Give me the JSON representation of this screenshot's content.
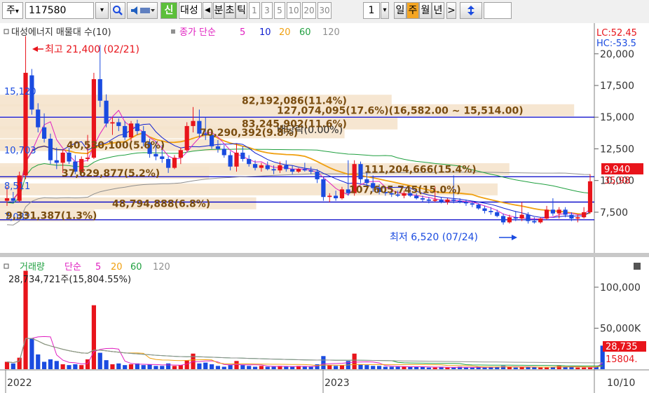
{
  "toolbar": {
    "period_type": "주",
    "stock_code": "117580",
    "new_badge": "신",
    "stock_name_prefix": "대성",
    "nav_prev": "◀",
    "unit_minute": "분",
    "unit_second": "초",
    "unit_tick": "틱",
    "interval_options": [
      "1",
      "3",
      "5",
      "10",
      "20",
      "30"
    ],
    "count": "1",
    "period_day": "일",
    "period_week": "주",
    "period_month": "월",
    "period_year": "년",
    "nav_next": ">",
    "dropdown_arrow": "▾"
  },
  "colors": {
    "up": "#e8141b",
    "down": "#1a4be0",
    "ma5": "#e020c0",
    "ma10": "#1020d0",
    "ma20": "#f0a010",
    "ma60": "#20a040",
    "ma120": "#909090",
    "hline": "#0000c8",
    "vp_band": "#f5e3cc",
    "vp_text": "#7a4d10"
  },
  "chart_data": [
    {
      "type": "candlestick",
      "legend": {
        "vp_label": "대성에너지 매물대 수(10)",
        "ma_label": "종가 단순",
        "ma_periods": [
          "5",
          "10",
          "20",
          "60",
          "120"
        ]
      },
      "y_ticks": [
        "20,000",
        "17,500",
        "15,000",
        "12,500",
        "10,000",
        "7,500"
      ],
      "y_tick_values": [
        20000,
        17500,
        15000,
        12500,
        10000,
        7500
      ],
      "ylim": [
        4400,
        22200
      ],
      "top_labels": [
        "LC:52.45",
        "HC:-53.5"
      ],
      "price_tag": "9,940",
      "prev_tag": "35,98",
      "max_annotation": "최고 21,400 (02/21)",
      "min_annotation": "최저 6,520 (07/24)",
      "dividend_label": "배당락(0.00%)",
      "left_labels": [
        "15,120",
        "10,703",
        "8,511",
        "7,082"
      ],
      "horizontal_lines": [
        15000,
        10300,
        8300,
        6900
      ],
      "volume_profile": [
        {
          "price": 16300,
          "label": "82,192,086(11.4%)"
        },
        {
          "price": 15550,
          "label": "127,074,095(17.6%)(16,582.00 ~ 15,514.00)"
        },
        {
          "price": 14500,
          "label": "83,245,902(11.6%)"
        },
        {
          "price": 13800,
          "label": "70,290,392(9.8%)"
        },
        {
          "price": 12800,
          "label": "40,530,100(5.6%)"
        },
        {
          "price": 10900,
          "label": "111,204,666(15.4%)"
        },
        {
          "price": 10600,
          "label": "37,629,877(5.2%)"
        },
        {
          "price": 9300,
          "label": "107,605,745(15.0%)"
        },
        {
          "price": 8200,
          "label": "48,794,888(6.8%)"
        },
        {
          "price": 7250,
          "label": "9,331,387(1.3%)"
        }
      ],
      "candles": [
        {
          "o": 8400,
          "h": 9500,
          "l": 8000,
          "c": 8600
        },
        {
          "o": 8600,
          "h": 9100,
          "l": 8200,
          "c": 8400
        },
        {
          "o": 8400,
          "h": 10700,
          "l": 8300,
          "c": 10400
        },
        {
          "o": 10400,
          "h": 21400,
          "l": 10100,
          "c": 18500
        },
        {
          "o": 18300,
          "h": 18800,
          "l": 15200,
          "c": 15600
        },
        {
          "o": 15600,
          "h": 16100,
          "l": 13800,
          "c": 14200
        },
        {
          "o": 14200,
          "h": 15300,
          "l": 13000,
          "c": 13300
        },
        {
          "o": 13300,
          "h": 13700,
          "l": 11300,
          "c": 11600
        },
        {
          "o": 11600,
          "h": 12600,
          "l": 10900,
          "c": 11400
        },
        {
          "o": 11400,
          "h": 12400,
          "l": 10600,
          "c": 12200
        },
        {
          "o": 12200,
          "h": 12600,
          "l": 11300,
          "c": 11500
        },
        {
          "o": 11500,
          "h": 12000,
          "l": 10500,
          "c": 10700
        },
        {
          "o": 10700,
          "h": 11900,
          "l": 10500,
          "c": 11700
        },
        {
          "o": 11700,
          "h": 13600,
          "l": 11500,
          "c": 11800
        },
        {
          "o": 11800,
          "h": 18500,
          "l": 11700,
          "c": 18000
        },
        {
          "o": 18000,
          "h": 20700,
          "l": 15800,
          "c": 16300
        },
        {
          "o": 16300,
          "h": 16800,
          "l": 14200,
          "c": 14500
        },
        {
          "o": 14500,
          "h": 15000,
          "l": 13600,
          "c": 14600
        },
        {
          "o": 14600,
          "h": 14900,
          "l": 13900,
          "c": 14300
        },
        {
          "o": 14300,
          "h": 14700,
          "l": 13200,
          "c": 13400
        },
        {
          "o": 13400,
          "h": 14700,
          "l": 13100,
          "c": 14500
        },
        {
          "o": 14500,
          "h": 14800,
          "l": 13600,
          "c": 13900
        },
        {
          "o": 13900,
          "h": 14300,
          "l": 12700,
          "c": 13000
        },
        {
          "o": 13000,
          "h": 13300,
          "l": 11800,
          "c": 12100
        },
        {
          "o": 12100,
          "h": 13100,
          "l": 11600,
          "c": 11900
        },
        {
          "o": 11900,
          "h": 12800,
          "l": 11400,
          "c": 11700
        },
        {
          "o": 11700,
          "h": 11900,
          "l": 10600,
          "c": 11000
        },
        {
          "o": 11000,
          "h": 12000,
          "l": 10900,
          "c": 11800
        },
        {
          "o": 11800,
          "h": 12600,
          "l": 11300,
          "c": 12400
        },
        {
          "o": 12400,
          "h": 14600,
          "l": 12300,
          "c": 14300
        },
        {
          "o": 14300,
          "h": 15800,
          "l": 13800,
          "c": 14700
        },
        {
          "o": 14700,
          "h": 15600,
          "l": 13400,
          "c": 13700
        },
        {
          "o": 13700,
          "h": 15000,
          "l": 13200,
          "c": 13600
        },
        {
          "o": 13600,
          "h": 13900,
          "l": 12500,
          "c": 12700
        },
        {
          "o": 12700,
          "h": 13200,
          "l": 12200,
          "c": 12500
        },
        {
          "o": 12500,
          "h": 12800,
          "l": 11800,
          "c": 12000
        },
        {
          "o": 12000,
          "h": 12300,
          "l": 10800,
          "c": 11100
        },
        {
          "o": 11100,
          "h": 12900,
          "l": 10700,
          "c": 12200
        },
        {
          "o": 12200,
          "h": 12700,
          "l": 11500,
          "c": 11700
        },
        {
          "o": 11700,
          "h": 12000,
          "l": 11100,
          "c": 11300
        },
        {
          "o": 11300,
          "h": 11600,
          "l": 10800,
          "c": 11000
        },
        {
          "o": 11000,
          "h": 11400,
          "l": 10700,
          "c": 11200
        },
        {
          "o": 11200,
          "h": 11500,
          "l": 10800,
          "c": 10900
        },
        {
          "o": 10900,
          "h": 11200,
          "l": 10500,
          "c": 10800
        },
        {
          "o": 10800,
          "h": 11500,
          "l": 10600,
          "c": 11200
        },
        {
          "o": 11200,
          "h": 11600,
          "l": 10700,
          "c": 10900
        },
        {
          "o": 10900,
          "h": 11200,
          "l": 10500,
          "c": 10700
        },
        {
          "o": 10700,
          "h": 11000,
          "l": 10600,
          "c": 10900
        },
        {
          "o": 10900,
          "h": 11400,
          "l": 10700,
          "c": 10800
        },
        {
          "o": 10800,
          "h": 11100,
          "l": 10500,
          "c": 10700
        },
        {
          "o": 10700,
          "h": 10900,
          "l": 9800,
          "c": 10100
        },
        {
          "o": 10100,
          "h": 10300,
          "l": 8400,
          "c": 8700
        },
        {
          "o": 8700,
          "h": 9000,
          "l": 8300,
          "c": 8800
        },
        {
          "o": 8800,
          "h": 9200,
          "l": 8400,
          "c": 8600
        },
        {
          "o": 8600,
          "h": 9500,
          "l": 8500,
          "c": 9300
        },
        {
          "o": 9300,
          "h": 11600,
          "l": 8800,
          "c": 9000
        },
        {
          "o": 9000,
          "h": 11600,
          "l": 8800,
          "c": 11300
        },
        {
          "o": 11300,
          "h": 11500,
          "l": 9800,
          "c": 10100
        },
        {
          "o": 10100,
          "h": 10700,
          "l": 9500,
          "c": 9800
        },
        {
          "o": 9800,
          "h": 10400,
          "l": 9100,
          "c": 9400
        },
        {
          "o": 9400,
          "h": 9700,
          "l": 8900,
          "c": 9100
        },
        {
          "o": 9100,
          "h": 9500,
          "l": 8800,
          "c": 9000
        },
        {
          "o": 9000,
          "h": 9300,
          "l": 8700,
          "c": 8900
        },
        {
          "o": 8900,
          "h": 9200,
          "l": 8700,
          "c": 8800
        },
        {
          "o": 8800,
          "h": 9200,
          "l": 8600,
          "c": 9000
        },
        {
          "o": 9000,
          "h": 9300,
          "l": 8700,
          "c": 8800
        },
        {
          "o": 8800,
          "h": 9000,
          "l": 8500,
          "c": 8600
        },
        {
          "o": 8600,
          "h": 8800,
          "l": 8300,
          "c": 8500
        },
        {
          "o": 8500,
          "h": 8700,
          "l": 8200,
          "c": 8400
        },
        {
          "o": 8400,
          "h": 9500,
          "l": 8300,
          "c": 8500
        },
        {
          "o": 8500,
          "h": 8700,
          "l": 8200,
          "c": 8300
        },
        {
          "o": 8300,
          "h": 8600,
          "l": 8100,
          "c": 8500
        },
        {
          "o": 8500,
          "h": 10400,
          "l": 8200,
          "c": 8400
        },
        {
          "o": 8400,
          "h": 8600,
          "l": 8200,
          "c": 8300
        },
        {
          "o": 8300,
          "h": 8500,
          "l": 8000,
          "c": 8200
        },
        {
          "o": 8200,
          "h": 8400,
          "l": 7900,
          "c": 8100
        },
        {
          "o": 8100,
          "h": 8200,
          "l": 7700,
          "c": 7800
        },
        {
          "o": 7800,
          "h": 8000,
          "l": 7400,
          "c": 7600
        },
        {
          "o": 7600,
          "h": 7900,
          "l": 7300,
          "c": 7500
        },
        {
          "o": 7500,
          "h": 7700,
          "l": 7100,
          "c": 7200
        },
        {
          "o": 7200,
          "h": 7400,
          "l": 6520,
          "c": 6700
        },
        {
          "o": 6700,
          "h": 7300,
          "l": 6600,
          "c": 7100
        },
        {
          "o": 7100,
          "h": 7600,
          "l": 6800,
          "c": 7000
        },
        {
          "o": 7000,
          "h": 8300,
          "l": 6800,
          "c": 7300
        },
        {
          "o": 7300,
          "h": 7500,
          "l": 6600,
          "c": 6800
        },
        {
          "o": 6800,
          "h": 7100,
          "l": 6600,
          "c": 6700
        },
        {
          "o": 6700,
          "h": 7100,
          "l": 6600,
          "c": 7000
        },
        {
          "o": 7000,
          "h": 8000,
          "l": 6900,
          "c": 7700
        },
        {
          "o": 7700,
          "h": 8600,
          "l": 7200,
          "c": 7400
        },
        {
          "o": 7400,
          "h": 7900,
          "l": 7000,
          "c": 7700
        },
        {
          "o": 7700,
          "h": 7900,
          "l": 7100,
          "c": 7300
        },
        {
          "o": 7300,
          "h": 7500,
          "l": 6800,
          "c": 7000
        },
        {
          "o": 7000,
          "h": 7300,
          "l": 6700,
          "c": 7100
        },
        {
          "o": 7100,
          "h": 7900,
          "l": 7000,
          "c": 7500
        },
        {
          "o": 7500,
          "h": 10500,
          "l": 7400,
          "c": 9940
        }
      ]
    },
    {
      "type": "bar",
      "legend": {
        "name": "거래량",
        "ma_label": "단순",
        "ma_periods": [
          "5",
          "20",
          "60",
          "120"
        ],
        "last_value": "28,734,721주(15,804.55%)"
      },
      "y_ticks": [
        "100,000",
        "50,000K"
      ],
      "y_tick_values": [
        100000,
        50000
      ],
      "ylim": [
        0,
        135000
      ],
      "last_tag": "28,735",
      "ma_tag": "15804.",
      "volumes": [
        9000,
        7000,
        14000,
        120000,
        38000,
        18000,
        9000,
        12000,
        10000,
        6000,
        5000,
        6000,
        5000,
        12000,
        78000,
        20000,
        11000,
        6000,
        7000,
        5000,
        6000,
        7000,
        5000,
        6000,
        4000,
        4000,
        7000,
        4000,
        5000,
        11000,
        19000,
        7000,
        8000,
        6000,
        4000,
        3000,
        5000,
        10000,
        5000,
        4000,
        3000,
        4000,
        3000,
        3000,
        4000,
        3000,
        3000,
        4000,
        3000,
        3000,
        6000,
        16000,
        5000,
        4000,
        5000,
        10000,
        19000,
        6000,
        5000,
        4000,
        4000,
        3000,
        3000,
        3000,
        3000,
        3000,
        3000,
        3000,
        2000,
        2000,
        3000,
        2000,
        2000,
        3000,
        2000,
        2000,
        3000,
        2000,
        3000,
        3000,
        4000,
        3000,
        2000,
        3000,
        3000,
        3000,
        2000,
        2000,
        3000,
        4000,
        3000,
        3000,
        2000,
        2000,
        2000,
        3000,
        28735
      ]
    }
  ],
  "axis": {
    "x_labels": [
      "2022",
      "2023"
    ],
    "footer_label": "10/10"
  }
}
